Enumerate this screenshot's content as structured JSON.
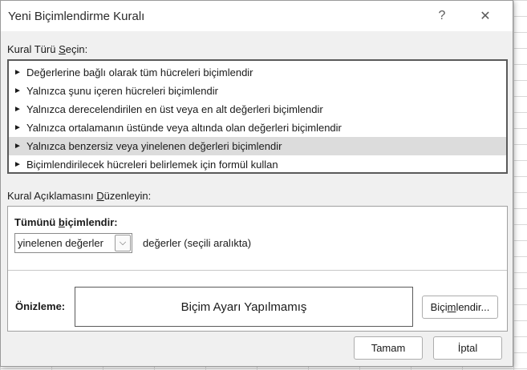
{
  "window": {
    "title": "Yeni Biçimlendirme Kuralı",
    "help_label": "?",
    "close_label": "✕"
  },
  "rule_type": {
    "label_before": "Kural Türü ",
    "label_accel": "S",
    "label_after": "eçin:",
    "arrow_glyph": "►",
    "items": [
      {
        "label": "Değerlerine bağlı olarak tüm hücreleri biçimlendir",
        "selected": false
      },
      {
        "label": "Yalnızca şunu içeren hücreleri biçimlendir",
        "selected": false
      },
      {
        "label": "Yalnızca derecelendirilen en üst veya en alt değerleri biçimlendir",
        "selected": false
      },
      {
        "label": "Yalnızca ortalamanın üstünde veya altında olan değerleri biçimlendir",
        "selected": false
      },
      {
        "label": "Yalnızca benzersiz veya yinelenen değerleri biçimlendir",
        "selected": true
      },
      {
        "label": "Biçimlendirilecek hücreleri belirlemek için formül kullan",
        "selected": false
      }
    ]
  },
  "description": {
    "label_before": "Kural Açıklamasını ",
    "label_accel": "D",
    "label_after": "üzenleyin:",
    "format_all_before": "Tümünü ",
    "format_all_accel": "b",
    "format_all_after": "içimlendir:",
    "dropdown_value": "yinelenen değerler",
    "dropdown_arrow": "⌵",
    "dropdown_suffix": "değerler (seçili aralıkta)"
  },
  "preview": {
    "label": "Önizleme:",
    "text": "Biçim Ayarı Yapılmamış",
    "format_button_before": "Biçi",
    "format_button_accel": "m",
    "format_button_after": "lendir..."
  },
  "footer": {
    "ok_label": "Tamam",
    "cancel_label": "İptal"
  },
  "colors": {
    "selected_row": "#dcdcdc",
    "dialog_bg": "#f0f0f0",
    "titlebar_bg": "#ffffff"
  }
}
